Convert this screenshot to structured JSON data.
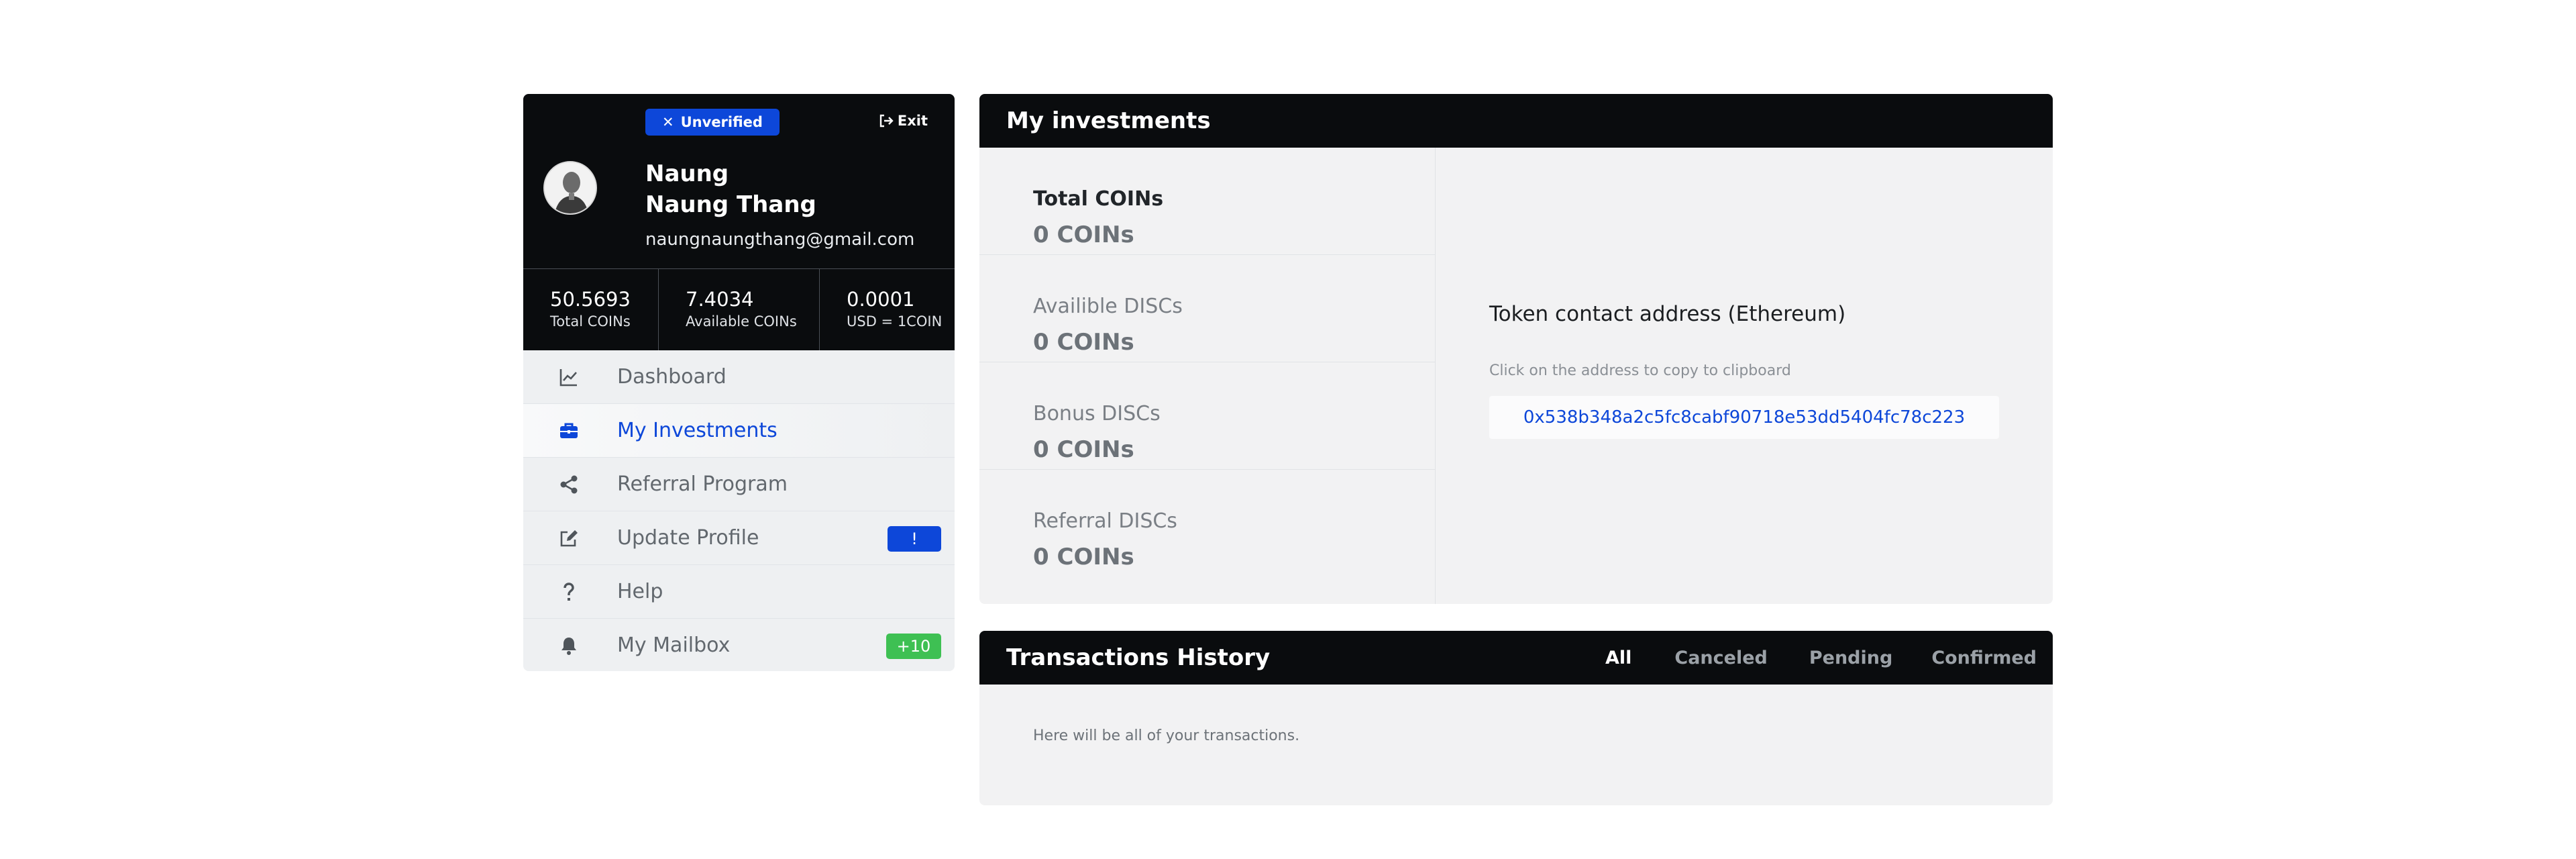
{
  "profile": {
    "status_badge": "Unverified",
    "exit_label": "Exit",
    "name": "Naung Naung Thang",
    "email": "naungnaungthang@gmail.com"
  },
  "stats": [
    {
      "value": "50.5693",
      "label": "Total COINs"
    },
    {
      "value": "7.4034",
      "label": "Available COINs"
    },
    {
      "value": "0.0001",
      "label": "USD = 1COIN"
    }
  ],
  "nav": {
    "items": [
      {
        "label": "Dashboard",
        "icon": "chart-line-icon"
      },
      {
        "label": "My Investments",
        "icon": "briefcase-icon",
        "active": true
      },
      {
        "label": "Referral Program",
        "icon": "share-icon"
      },
      {
        "label": "Update Profile",
        "icon": "edit-icon",
        "badge": "!"
      },
      {
        "label": "Help",
        "icon": "question-icon"
      },
      {
        "label": "My Mailbox",
        "icon": "bell-icon",
        "badge": "+10"
      }
    ]
  },
  "investments": {
    "title": "My investments",
    "rows": [
      {
        "label": "Total COINs",
        "value": "0 COINs"
      },
      {
        "label": "Availible DISCs",
        "value": "0 COINs"
      },
      {
        "label": "Bonus DISCs",
        "value": "0 COINs"
      },
      {
        "label": "Referral DISCs",
        "value": "0 COINs"
      }
    ],
    "token_title": "Token contact address (Ethereum)",
    "token_hint": "Click on the address to copy to clipboard",
    "token_address": "0x538b348a2c5fc8cabf90718e53dd5404fc78c223"
  },
  "transactions": {
    "title": "Transactions History",
    "tabs": [
      "All",
      "Canceled",
      "Pending",
      "Confirmed"
    ],
    "empty_text": "Here will be all of your transactions."
  },
  "colors": {
    "accent": "#0d47d9",
    "success": "#3ec053",
    "header_bg": "#0a0c0e"
  }
}
